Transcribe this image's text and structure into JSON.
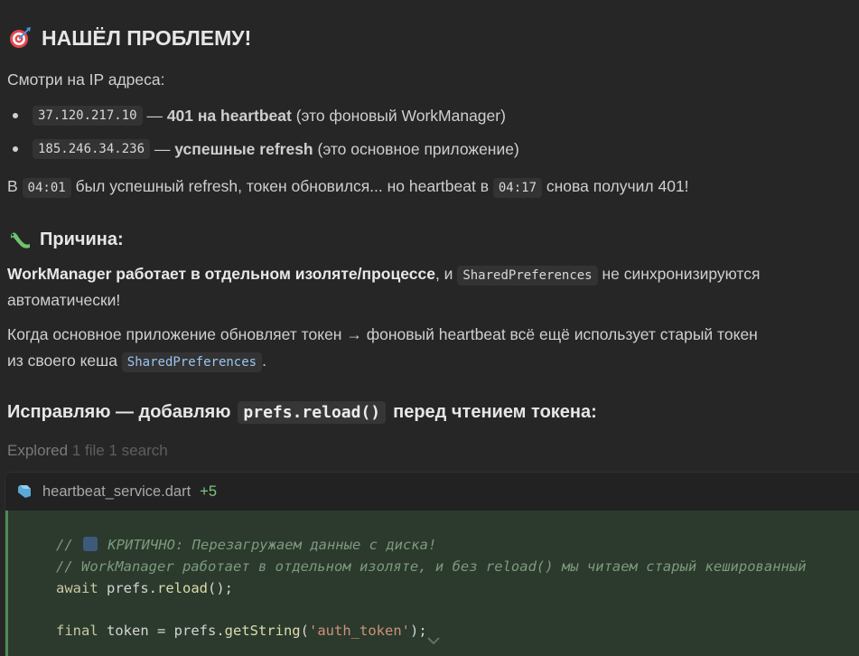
{
  "heading": {
    "emoji": "target-icon",
    "text": "НАШЁЛ ПРОБЛЕМУ!"
  },
  "intro": "Смотри на IP адреса:",
  "bullets": [
    {
      "code": "37.120.217.10",
      "dash": " — ",
      "bold": "401 на heartbeat",
      "rest": " (это фоновый WorkManager)"
    },
    {
      "code": "185.246.34.236",
      "dash": " — ",
      "bold": "успешные refresh",
      "rest": " (это основное приложение)"
    }
  ],
  "timeline": {
    "t1": "В ",
    "code1": "04:01",
    "t2": " был успешный refresh, токен обновился... но heartbeat в ",
    "code2": "04:17",
    "t3": " снова получил 401!"
  },
  "cause": {
    "emoji": "bug-icon",
    "title": "Причина:"
  },
  "cause_p1": {
    "bold": "WorkManager работает в отдельном изоляте/процессе",
    "t1": ", и ",
    "code": "SharedPreferences",
    "t2": " не синхронизируются",
    "line2": "автоматически!"
  },
  "cause_p2": {
    "line1": "Когда основное приложение обновляет токен → фоновый heartbeat всё ещё использует старый токен",
    "t1": "из своего кеша ",
    "code": "SharedPreferences",
    "t2": "."
  },
  "fix": {
    "t1": "Исправляю — добавляю",
    "code": "prefs.reload()",
    "t2": "перед чтением токена:"
  },
  "explored": {
    "label": "Explored",
    "detail": "1 file 1 search"
  },
  "code_card": {
    "filename": "heartbeat_service.dart",
    "added": "+5",
    "lines": {
      "l1a": "// ",
      "l1b": " КРИТИЧНО: Перезагружаем данные с диска!",
      "l2": "// WorkManager работает в отдельном изоляте, и без reload() мы читаем старый кешированный",
      "l3a": "await",
      "l3b": " prefs.",
      "l3c": "reload",
      "l3d": "();",
      "l4a": "final",
      "l4b": " token = prefs.",
      "l4c": "getString",
      "l4d": "(",
      "l4e": "'auth_token'",
      "l4f": ");"
    }
  }
}
